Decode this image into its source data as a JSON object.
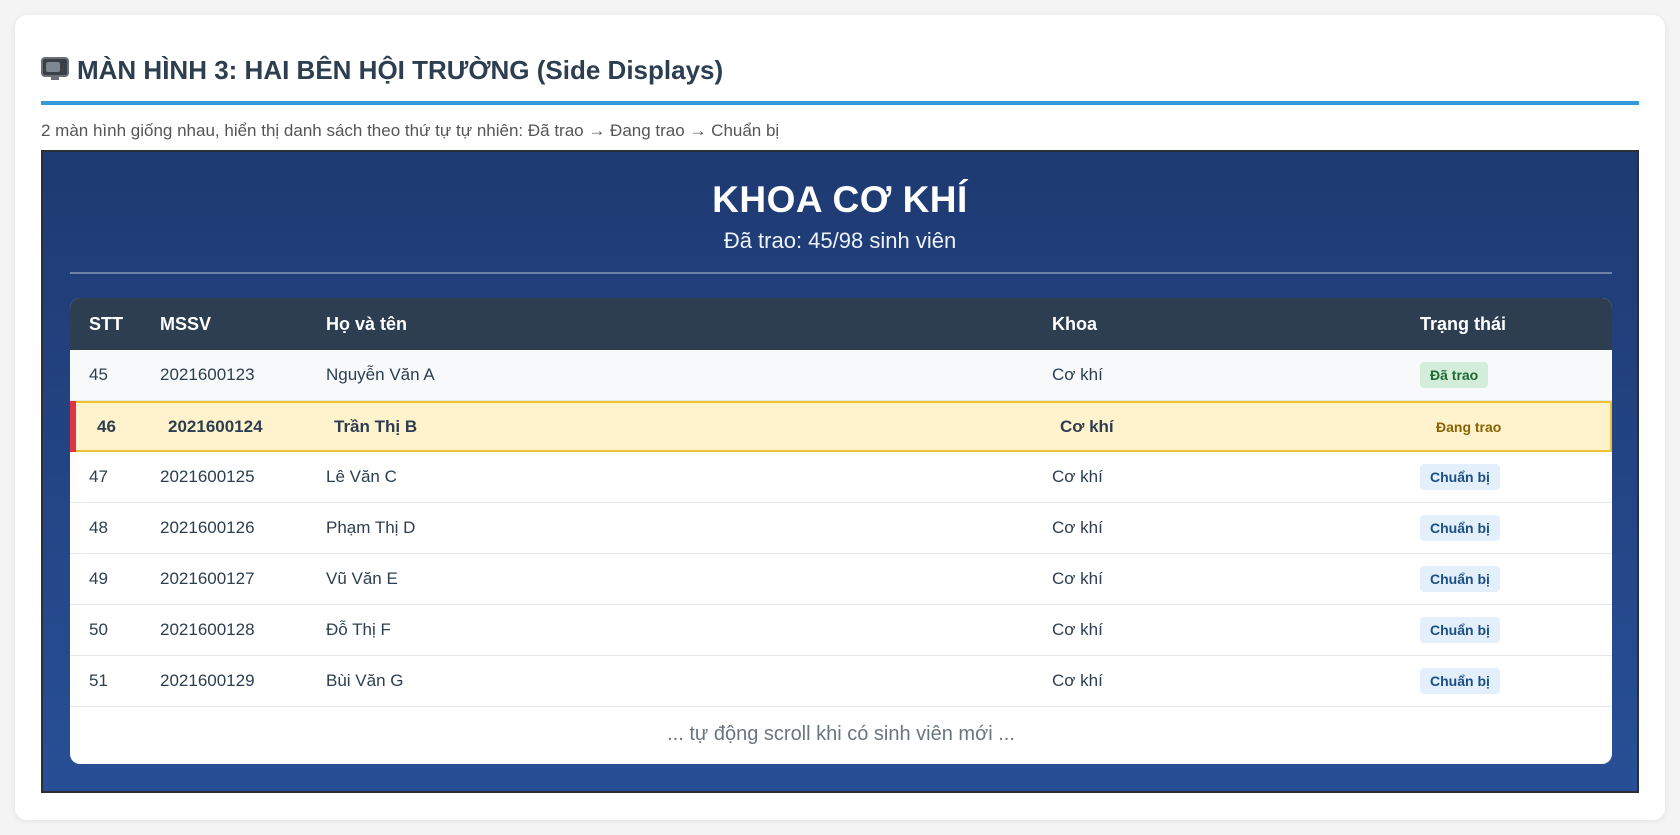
{
  "section": {
    "title": "MÀN HÌNH 3: HAI BÊN HỘI TRƯỜNG (Side Displays)",
    "icon": "tv-icon",
    "description": "2 màn hình giống nhau, hiển thị danh sách theo thứ tự tự nhiên: Đã trao → Đang trao → Chuẩn bị"
  },
  "display": {
    "title": "KHOA CƠ KHÍ",
    "subtitle": "Đã trao: 45/98 sinh viên",
    "columns": [
      "STT",
      "MSSV",
      "Họ và tên",
      "Khoa",
      "Trạng thái"
    ],
    "rows": [
      {
        "stt": "45",
        "mssv": "2021600123",
        "name": "Nguyễn Văn A",
        "khoa": "Cơ khí",
        "status": "Đã trao",
        "state": "done"
      },
      {
        "stt": "46",
        "mssv": "2021600124",
        "name": "Trần Thị B",
        "khoa": "Cơ khí",
        "status": "Đang trao",
        "state": "active"
      },
      {
        "stt": "47",
        "mssv": "2021600125",
        "name": "Lê Văn C",
        "khoa": "Cơ khí",
        "status": "Chuẩn bị",
        "state": "prep"
      },
      {
        "stt": "48",
        "mssv": "2021600126",
        "name": "Phạm Thị D",
        "khoa": "Cơ khí",
        "status": "Chuẩn bị",
        "state": "prep"
      },
      {
        "stt": "49",
        "mssv": "2021600127",
        "name": "Vũ Văn E",
        "khoa": "Cơ khí",
        "status": "Chuẩn bị",
        "state": "prep"
      },
      {
        "stt": "50",
        "mssv": "2021600128",
        "name": "Đỗ Thị F",
        "khoa": "Cơ khí",
        "status": "Chuẩn bị",
        "state": "prep"
      },
      {
        "stt": "51",
        "mssv": "2021600129",
        "name": "Bùi Văn G",
        "khoa": "Cơ khí",
        "status": "Chuẩn bị",
        "state": "prep"
      }
    ],
    "footer_note": "... tự động scroll khi có sinh viên mới ..."
  },
  "colors": {
    "accent": "#3498db",
    "display_bg": "#1e3a72",
    "header_bg": "#2c3e50",
    "active_row": "#fff3cd",
    "active_marker": "#dc3545"
  }
}
